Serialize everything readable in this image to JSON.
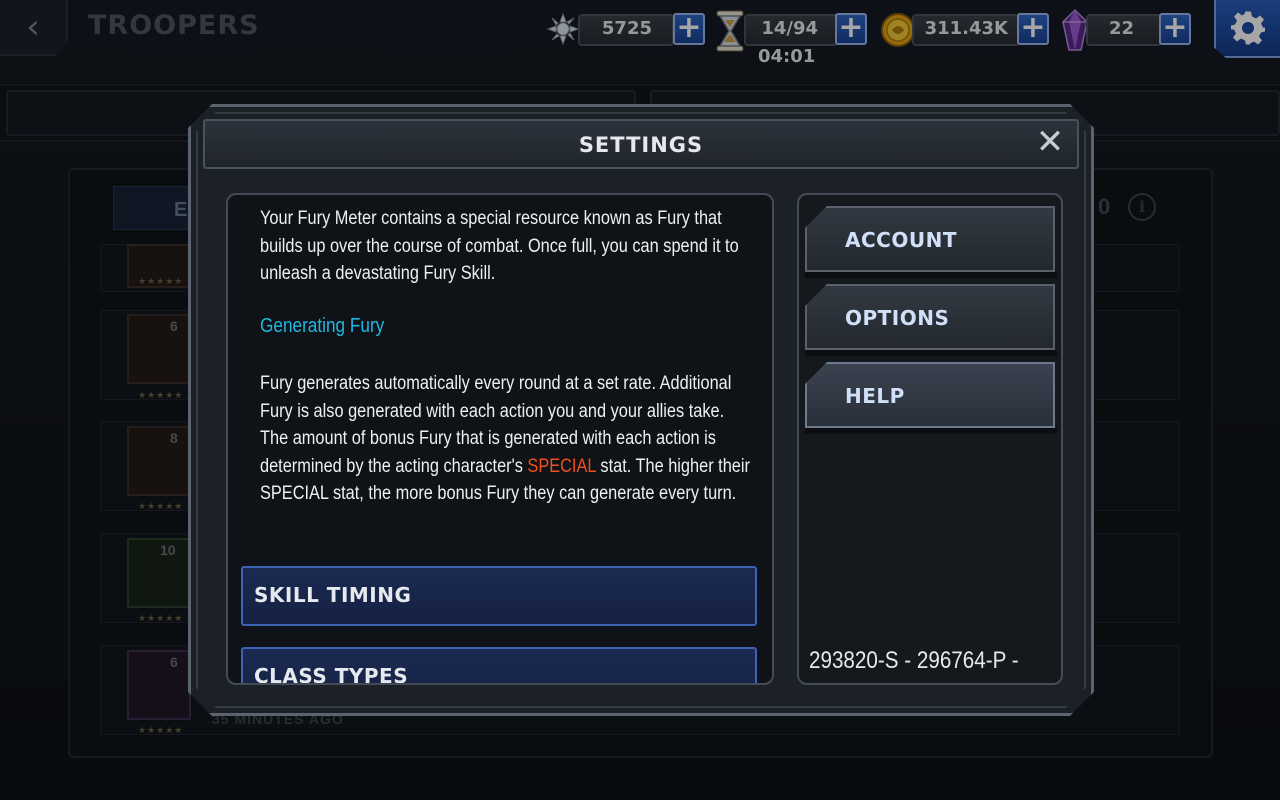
{
  "background": {
    "back_icon": "chevron-left-icon",
    "screen_title": "TROOPERS",
    "filter_label": "E",
    "sort_value": "0",
    "info_icon": "info-icon",
    "rows": [
      {
        "level": ""
      },
      {
        "level": "6"
      },
      {
        "level": "8"
      },
      {
        "level": "10"
      },
      {
        "level": "6"
      }
    ],
    "last_row_time": "35 MINUTES AGO",
    "stars": "★★★★★"
  },
  "resources": {
    "alliance_points": {
      "icon": "alliance-points-icon",
      "value": "5725"
    },
    "energy": {
      "icon": "hourglass-icon",
      "value": "14/94",
      "timer": "04:01"
    },
    "gold": {
      "icon": "gold-coin-icon",
      "value": "311.43K"
    },
    "crystals": {
      "icon": "crystal-icon",
      "value": "22"
    },
    "plus_label": "+"
  },
  "settings_button": {
    "icon": "gear-icon"
  },
  "modal": {
    "title": "SETTINGS",
    "close_label": "✕",
    "help": {
      "intro": "Your Fury Meter contains a special resource known as Fury that builds up over the course of combat. Once full, you can spend it to unleash a devastating Fury Skill.",
      "heading": "Generating Fury",
      "body_before": "Fury generates automatically every round at a set rate. Additional Fury is also generated with each action you and your allies take. The amount of bonus Fury that is generated with each action is determined by the acting character's ",
      "body_special": "SPECIAL",
      "body_after": " stat. The higher their SPECIAL stat, the more bonus Fury they can generate every turn.",
      "sections": [
        "SKILL TIMING",
        "CLASS TYPES"
      ]
    },
    "nav": [
      {
        "label": "ACCOUNT",
        "active": false
      },
      {
        "label": "OPTIONS",
        "active": false
      },
      {
        "label": "HELP",
        "active": true
      }
    ],
    "build_id": "293820-S - 296764-P -"
  },
  "colors": {
    "accent_blue": "#2f66c8",
    "heading_cyan": "#1fb8e0",
    "special_orange": "#f0501e",
    "panel_bg": "#0f1217"
  }
}
